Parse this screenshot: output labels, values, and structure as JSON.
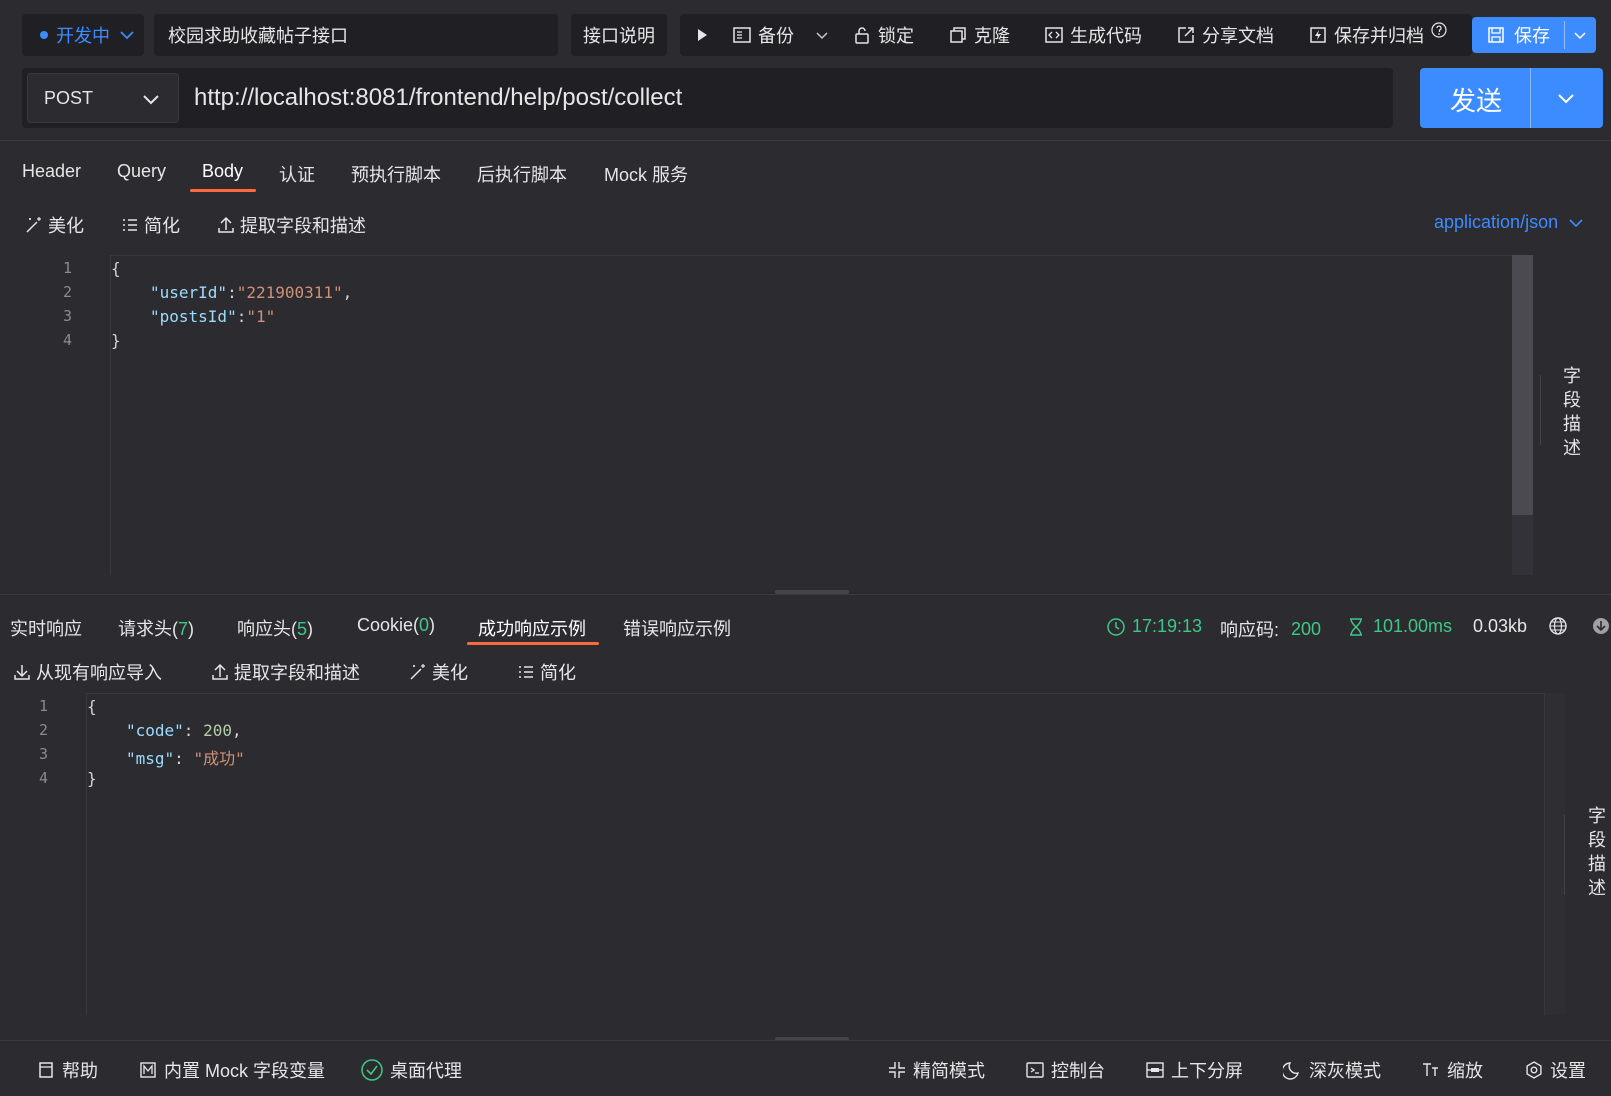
{
  "toolbar": {
    "status": "开发中",
    "api_title": "校园求助收藏帖子接口",
    "doc_label": "接口说明",
    "backup": "备份",
    "lock": "锁定",
    "clone": "克隆",
    "gen_code": "生成代码",
    "share_doc": "分享文档",
    "save_archive": "保存并归档",
    "save": "保存"
  },
  "request": {
    "method": "POST",
    "url": "http://localhost:8081/frontend/help/post/collect",
    "send": "发送",
    "tabs": [
      "Header",
      "Query",
      "Body",
      "认证",
      "预执行脚本",
      "后执行脚本",
      "Mock 服务"
    ],
    "active_tab": "Body",
    "body_tools": {
      "beautify": "美化",
      "simplify": "简化",
      "extract": "提取字段和描述"
    },
    "content_type": "application/json",
    "side_label": "字段描述",
    "line_numbers": [
      "1",
      "2",
      "3",
      "4"
    ],
    "body_lines": {
      "open": "{",
      "l2_key": "\"userId\"",
      "l2_sep": ":",
      "l2_val": "\"221900311\"",
      "l2_end": ",",
      "l3_key": "\"postsId\"",
      "l3_sep": ":",
      "l3_val": "\"1\"",
      "close": "}"
    }
  },
  "response": {
    "tabs": {
      "realtime": "实时响应",
      "req_headers": "请求头(",
      "req_headers_count": "7",
      "res_headers": "响应头(",
      "res_headers_count": "5",
      "cookie": "Cookie(",
      "cookie_count": "0",
      "close_paren": ")",
      "success_example": "成功响应示例",
      "error_example": "错误响应示例"
    },
    "time": "17:19:13",
    "code_label": "响应码:",
    "code": "200",
    "duration": "101.00ms",
    "size": "0.03kb",
    "tools": {
      "import": "从现有响应导入",
      "extract": "提取字段和描述",
      "beautify": "美化",
      "simplify": "简化"
    },
    "side_label": "字段描述",
    "line_numbers": [
      "1",
      "2",
      "3",
      "4"
    ],
    "body_lines": {
      "open": "{",
      "l2_key": "\"code\"",
      "l2_sep": ": ",
      "l2_val": "200",
      "l2_end": ",",
      "l3_key": "\"msg\"",
      "l3_sep": ": ",
      "l3_val": "\"成功\"",
      "close": "}"
    }
  },
  "footer": {
    "help": "帮助",
    "mock_vars": "内置 Mock 字段变量",
    "desktop_proxy": "桌面代理",
    "compact_mode": "精简模式",
    "console": "控制台",
    "split": "上下分屏",
    "dark_mode": "深灰模式",
    "zoom": "缩放",
    "settings": "设置"
  },
  "colors": {
    "accent": "#3d8cff",
    "tab_underline": "#ff6a3d",
    "success": "#3fc785"
  }
}
